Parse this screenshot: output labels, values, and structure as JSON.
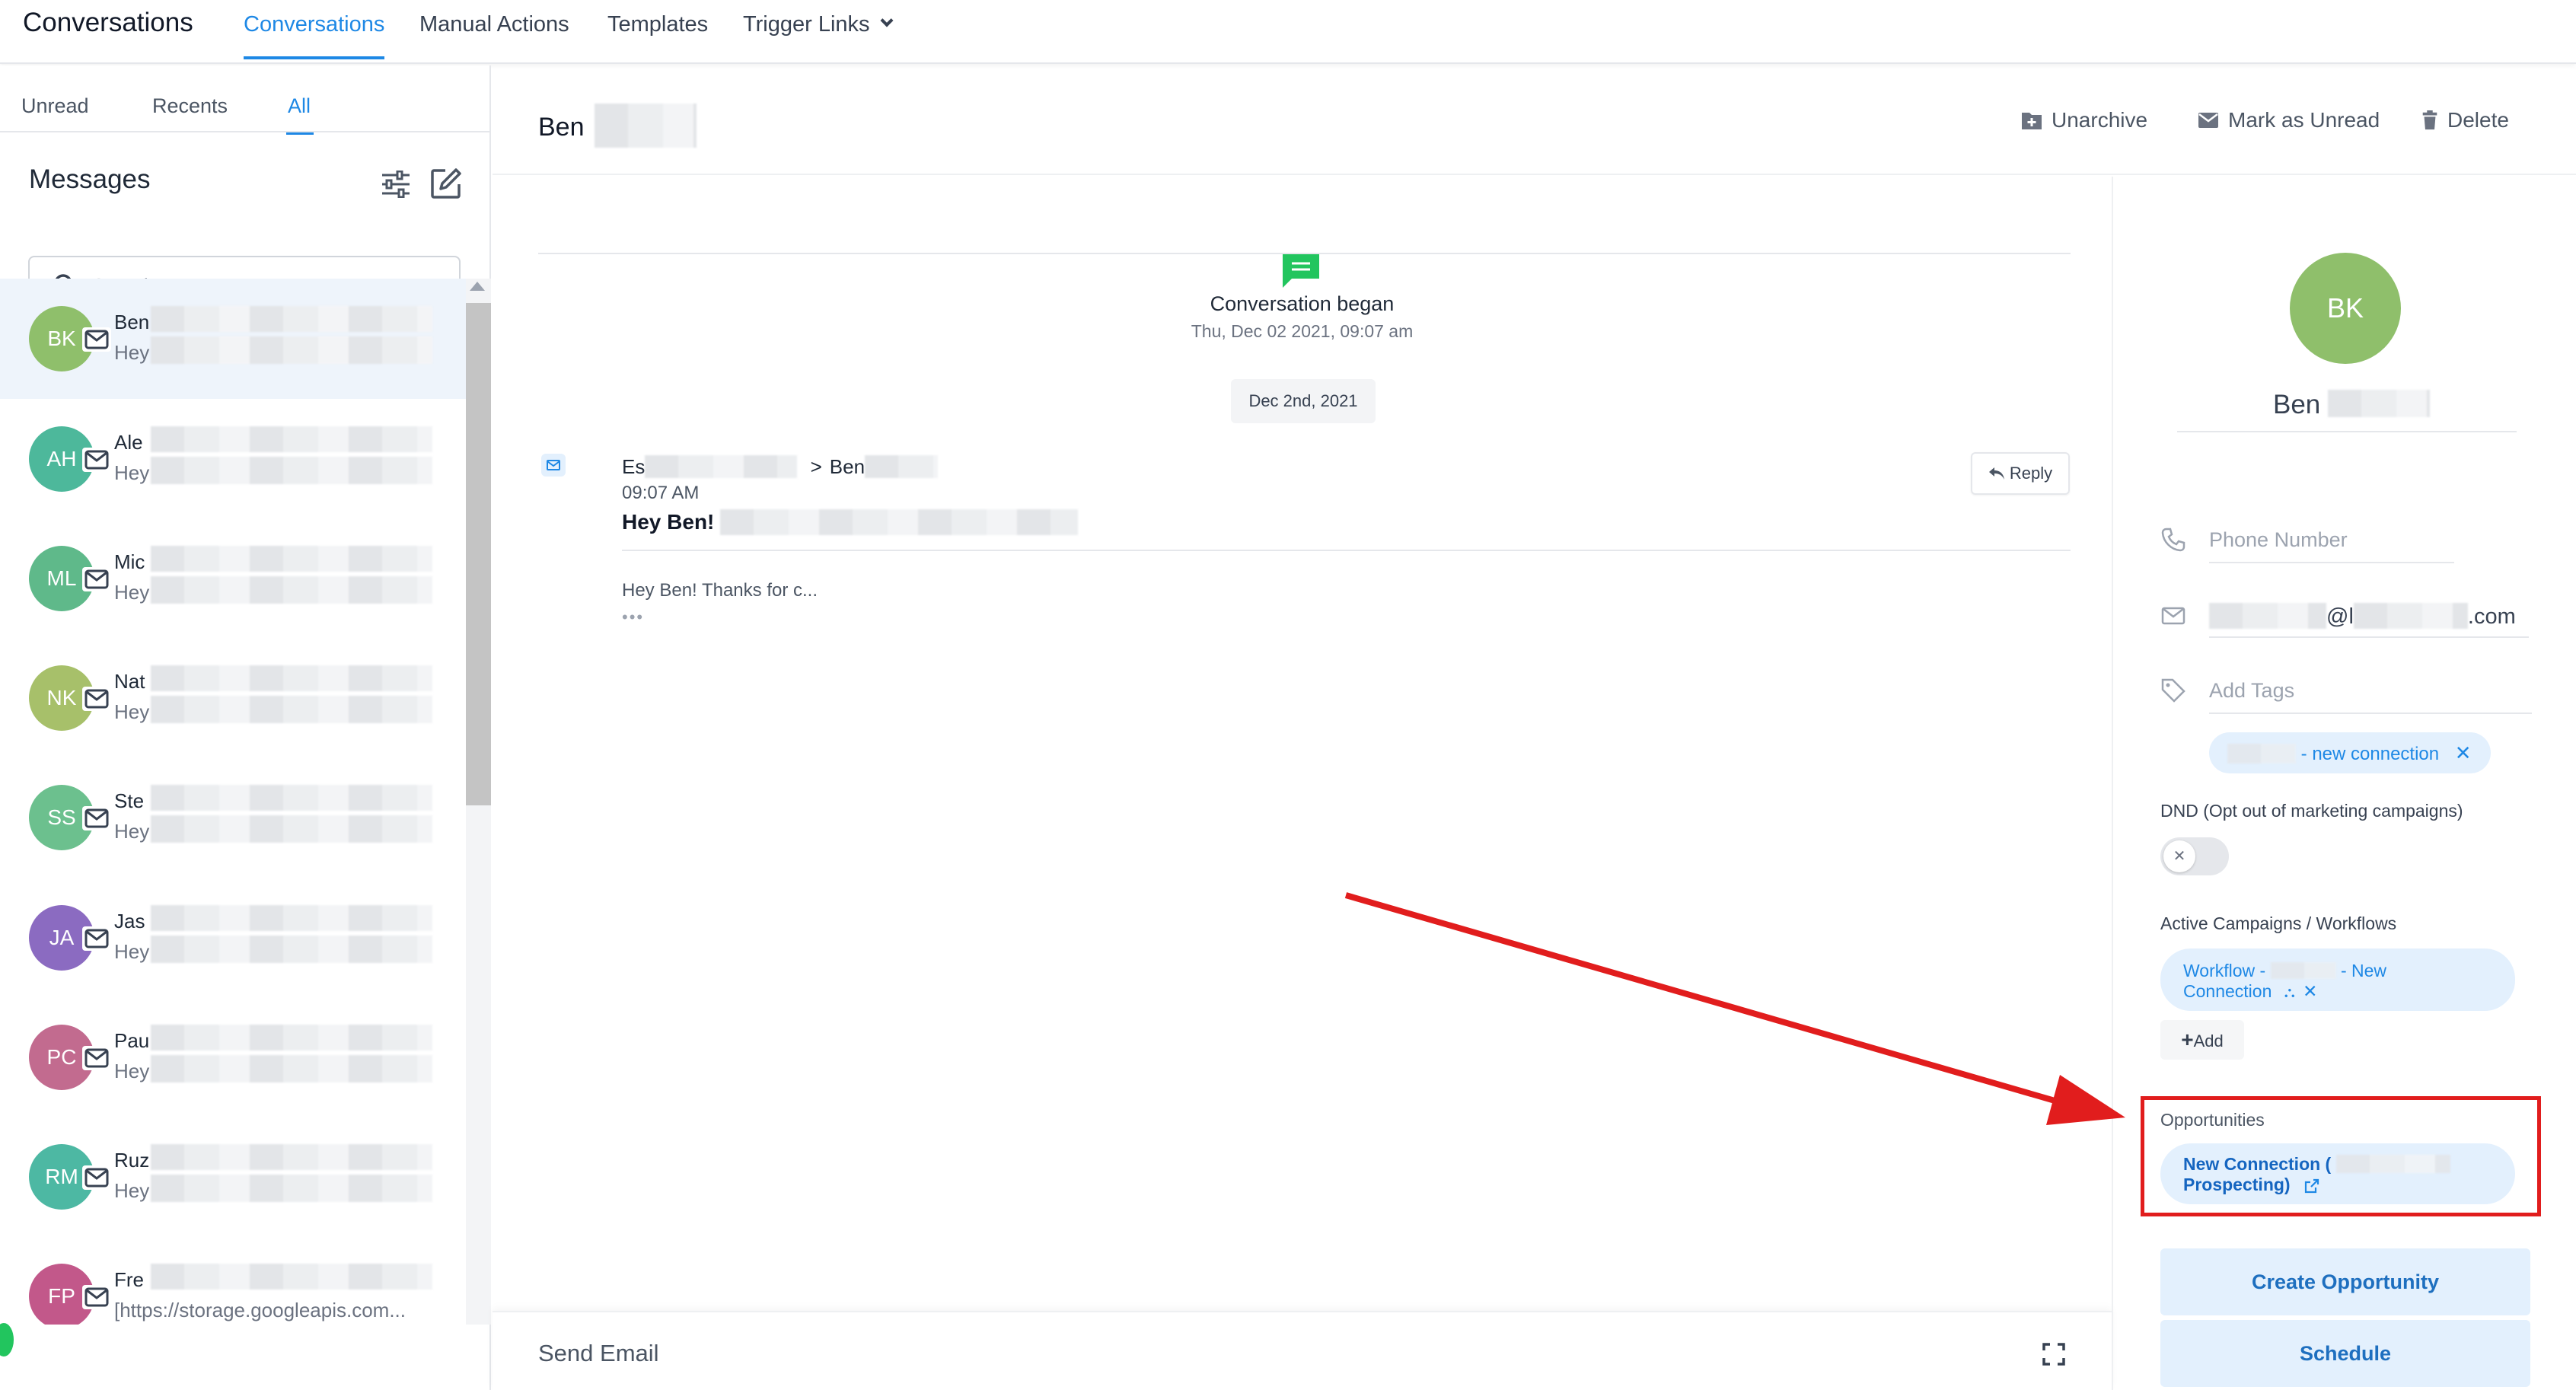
{
  "nav": {
    "app_title": "Conversations",
    "tabs": [
      "Conversations",
      "Manual Actions",
      "Templates",
      "Trigger Links"
    ]
  },
  "left": {
    "subtabs": [
      "Unread",
      "Recents",
      "All"
    ],
    "messages_title": "Messages",
    "search_placeholder": "Search",
    "items": [
      {
        "initials": "BK",
        "name": "Ben",
        "preview": "Hey",
        "color": "#8fbf6b"
      },
      {
        "initials": "AH",
        "name": "Ale",
        "preview": "Hey",
        "color": "#4db89b"
      },
      {
        "initials": "ML",
        "name": "Mic",
        "preview": "Hey",
        "color": "#5fb98a"
      },
      {
        "initials": "NK",
        "name": "Nat",
        "preview": "Hey",
        "color": "#a7c06a"
      },
      {
        "initials": "SS",
        "name": "Ste",
        "preview": "Hey",
        "color": "#6cc08e"
      },
      {
        "initials": "JA",
        "name": "Jas",
        "preview": "Hey",
        "color": "#8b6bc1"
      },
      {
        "initials": "PC",
        "name": "Pau",
        "preview": "Hey",
        "color": "#c26b8f"
      },
      {
        "initials": "RM",
        "name": "Ruz",
        "preview": "Hey",
        "color": "#4db8a3"
      },
      {
        "initials": "FP",
        "name": "Fre",
        "preview": "[https://storage.googleapis.com...",
        "color": "#c2588a"
      }
    ]
  },
  "header": {
    "contact_name": "Ben",
    "actions": [
      "Unarchive",
      "Mark as Unread",
      "Delete"
    ]
  },
  "thread": {
    "began": "Conversation began",
    "began_time": "Thu, Dec 02 2021, 09:07 am",
    "date_pill": "Dec 2nd, 2021",
    "from": "Es",
    "to_separator": ">",
    "to": "Ben",
    "time": "09:07 AM",
    "subject": "Hey Ben!",
    "reply": "Reply",
    "snippet": "Hey Ben! Thanks for c...",
    "more": "•••",
    "composer_label": "Send Email"
  },
  "contact": {
    "initials": "BK",
    "name": "Ben",
    "phone_placeholder": "Phone Number",
    "email_at": "@l",
    "email_end": ".com",
    "tags_placeholder": "Add Tags",
    "tag": "- new connection",
    "dnd_label": "DND (Opt out of marketing campaigns)",
    "campaigns_label": "Active Campaigns / Workflows",
    "workflow_prefix": "Workflow -",
    "workflow_suffix": "- New",
    "workflow_line2": "Connection",
    "add": "Add",
    "opportunities_label": "Opportunities",
    "opportunity_line1": "New Connection (",
    "opportunity_line2": "Prospecting)",
    "create_opportunity": "Create Opportunity",
    "schedule": "Schedule"
  },
  "colors": {
    "accent": "#1e88e5",
    "annotation": "#e11d1d"
  }
}
